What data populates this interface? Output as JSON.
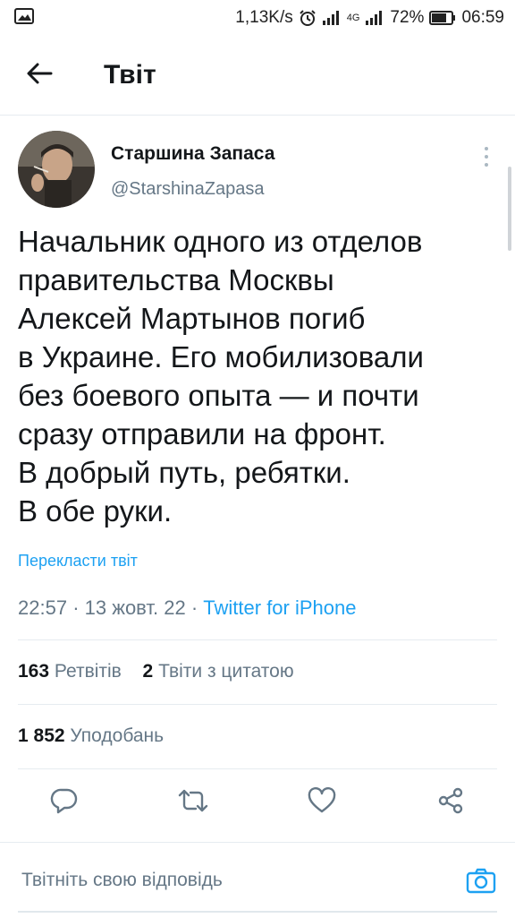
{
  "status_bar": {
    "speed": "1,13K/s",
    "network": "4G",
    "battery": "72%",
    "time": "06:59"
  },
  "header": {
    "title": "Твіт"
  },
  "tweet": {
    "author_name": "Старшина Запаса",
    "author_handle": "@StarshinaZapasa",
    "text_lines": [
      "Начальник одного из отделов",
      "правительства Москвы",
      "Алексей Мартынов погиб",
      "в Украине. Его мобилизовали",
      "без боевого опыта — и почти",
      "сразу отправили на фронт.",
      "В добрый путь, ребятки.",
      "В обе руки."
    ],
    "translate_label": "Перекласти твіт",
    "time": "22:57",
    "date": "13 жовт. 22",
    "separator": "·",
    "source": "Twitter for iPhone"
  },
  "stats": {
    "retweets_count": "163",
    "retweets_label": "Ретвітів",
    "quotes_count": "2",
    "quotes_label": "Твіти з цитатою",
    "likes_count": "1 852",
    "likes_label": "Уподобань"
  },
  "actions": [
    "reply-icon",
    "retweet-icon",
    "like-icon",
    "share-icon"
  ],
  "reply": {
    "placeholder": "Твітніть свою відповідь"
  },
  "colors": {
    "accent": "#1da1f2",
    "text": "#14171a",
    "secondary": "#657786",
    "icon": "#657786",
    "divider": "#e6ecf0"
  }
}
